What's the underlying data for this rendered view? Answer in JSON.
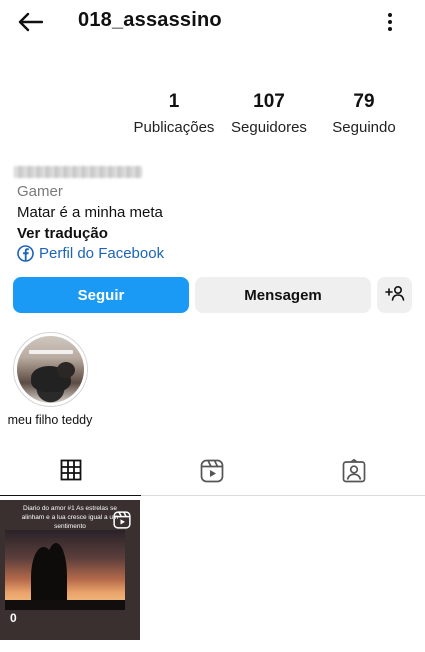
{
  "header": {
    "username": "018_assassino"
  },
  "stats": [
    {
      "value": "1",
      "label": "Publicações"
    },
    {
      "value": "107",
      "label": "Seguidores"
    },
    {
      "value": "79",
      "label": "Seguindo"
    }
  ],
  "profile": {
    "category": "Gamer",
    "bio": "Matar é a minha meta",
    "translate_label": "Ver tradução",
    "facebook_label": "Perfil do Facebook"
  },
  "actions": {
    "follow_label": "Seguir",
    "message_label": "Mensagem"
  },
  "highlights": [
    {
      "label": "meu filho teddy"
    }
  ],
  "tabs": [
    {
      "icon": "grid-icon"
    },
    {
      "icon": "reels-icon"
    },
    {
      "icon": "tagged-icon"
    }
  ],
  "posts": [
    {
      "overlay_text": "Diario do amor #1 As estrelas se alinham e a lua cresce igual a um sentimento",
      "views": "0"
    }
  ],
  "colors": {
    "accent": "#1a9af5",
    "link": "#1d64b8",
    "secondary_button": "#efefef"
  }
}
